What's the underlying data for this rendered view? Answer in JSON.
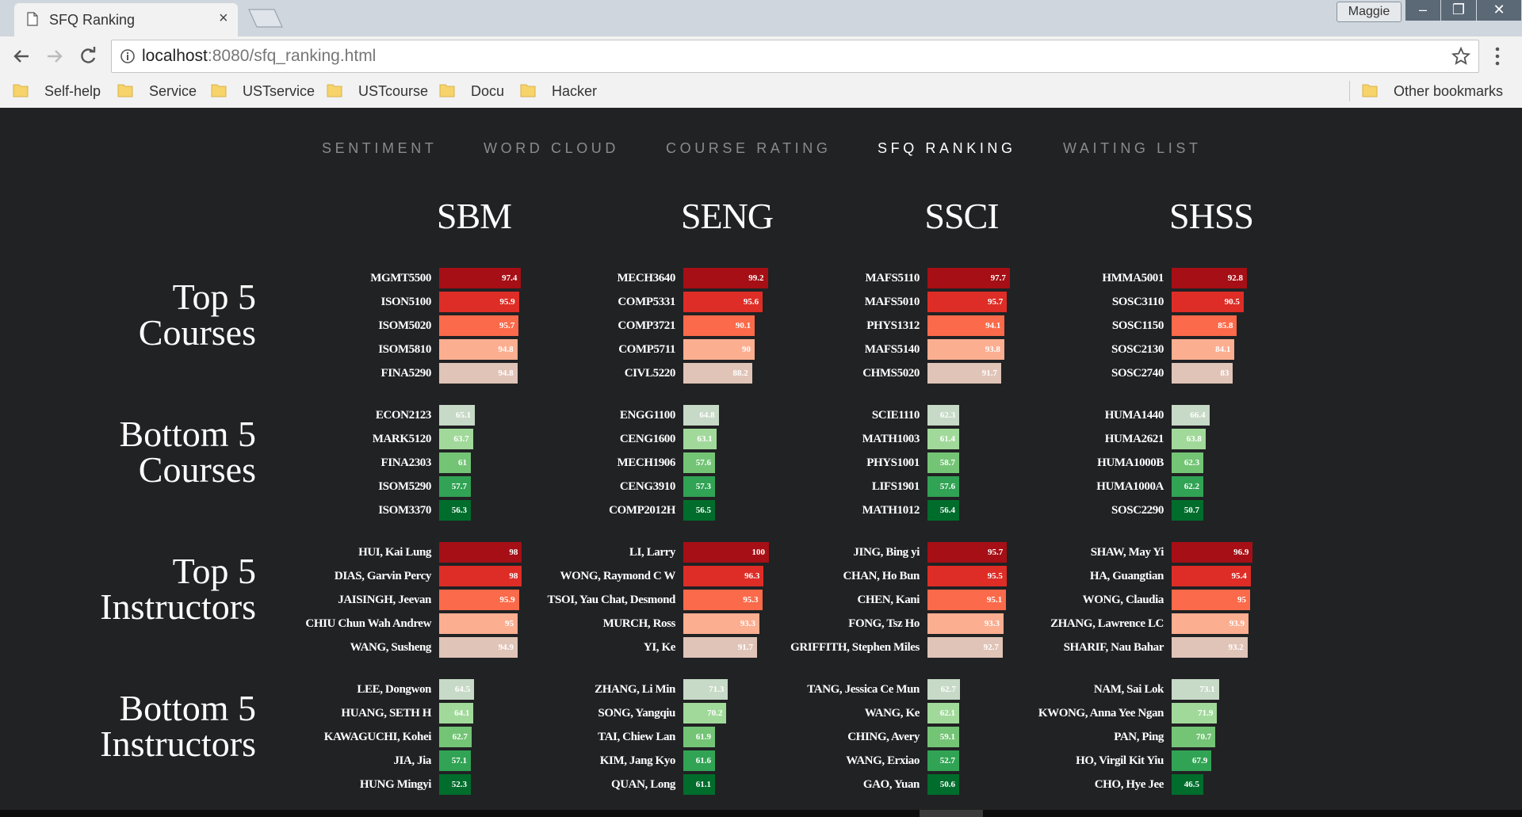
{
  "browser": {
    "tab_title": "SFQ Ranking",
    "url_host": "localhost",
    "url_rest": ":8080/sfq_ranking.html",
    "profile_name": "Maggie",
    "bookmarks": [
      "Self-help",
      "Service",
      "USTservice",
      "USTcourse",
      "Docu",
      "Hacker"
    ],
    "other_bookmarks": "Other bookmarks"
  },
  "nav": {
    "items": [
      "SENTIMENT",
      "WORD CLOUD",
      "COURSE RATING",
      "SFQ RANKING",
      "WAITING LIST"
    ],
    "active": "SFQ RANKING"
  },
  "schools": [
    "SBM",
    "SENG",
    "SSCI",
    "SHSS"
  ],
  "sections": [
    {
      "title_line1": "Top 5",
      "title_line2": "Courses",
      "kind": "top"
    },
    {
      "title_line1": "Bottom 5",
      "title_line2": "Courses",
      "kind": "bottom"
    },
    {
      "title_line1": "Top 5",
      "title_line2": "Instructors",
      "kind": "top"
    },
    {
      "title_line1": "Bottom 5",
      "title_line2": "Instructors",
      "kind": "bottom"
    }
  ],
  "colors": {
    "top": [
      "#a50f15",
      "#de2d26",
      "#fb6a4a",
      "#fcae91",
      "#e0c4b8"
    ],
    "bottom": [
      "#c7d9c7",
      "#a1d99b",
      "#74c476",
      "#31a354",
      "#006d2c"
    ],
    "background": "#212224"
  },
  "chart_data": {
    "type": "bar",
    "value_scale_max": 100,
    "rankings": [
      [
        [
          [
            "MGMT5500",
            97.4
          ],
          [
            "ISON5100",
            95.9
          ],
          [
            "ISOM5020",
            95.7
          ],
          [
            "ISOM5810",
            94.8
          ],
          [
            "FINA5290",
            94.8
          ]
        ],
        [
          [
            "MECH3640",
            99.2
          ],
          [
            "COMP5331",
            95.6
          ],
          [
            "COMP3721",
            90.1
          ],
          [
            "COMP5711",
            90
          ],
          [
            "CIVL5220",
            88.2
          ]
        ],
        [
          [
            "MAFS5110",
            97.7
          ],
          [
            "MAFS5010",
            95.7
          ],
          [
            "PHYS1312",
            94.1
          ],
          [
            "MAFS5140",
            93.8
          ],
          [
            "CHMS5020",
            91.7
          ]
        ],
        [
          [
            "HMMA5001",
            92.8
          ],
          [
            "SOSC3110",
            90.5
          ],
          [
            "SOSC1150",
            85.8
          ],
          [
            "SOSC2130",
            84.1
          ],
          [
            "SOSC2740",
            83
          ]
        ]
      ],
      [
        [
          [
            "ECON2123",
            65.1
          ],
          [
            "MARK5120",
            63.7
          ],
          [
            "FINA2303",
            61
          ],
          [
            "ISOM5290",
            57.7
          ],
          [
            "ISOM3370",
            56.3
          ]
        ],
        [
          [
            "ENGG1100",
            64.8
          ],
          [
            "CENG1600",
            63.1
          ],
          [
            "MECH1906",
            57.6
          ],
          [
            "CENG3910",
            57.3
          ],
          [
            "COMP2012H",
            56.5
          ]
        ],
        [
          [
            "SCIE1110",
            62.3
          ],
          [
            "MATH1003",
            61.4
          ],
          [
            "PHYS1001",
            58.7
          ],
          [
            "LIFS1901",
            57.6
          ],
          [
            "MATH1012",
            56.4
          ]
        ],
        [
          [
            "HUMA1440",
            66.4
          ],
          [
            "HUMA2621",
            63.8
          ],
          [
            "HUMA1000B",
            62.3
          ],
          [
            "HUMA1000A",
            62.2
          ],
          [
            "SOSC2290",
            50.7
          ]
        ]
      ],
      [
        [
          [
            "HUI, Kai Lung",
            98
          ],
          [
            "DIAS, Garvin Percy",
            98
          ],
          [
            "JAISINGH, Jeevan",
            95.9
          ],
          [
            "CHIU Chun Wah Andrew",
            95
          ],
          [
            "WANG, Susheng",
            94.9
          ]
        ],
        [
          [
            "LI, Larry",
            100
          ],
          [
            "WONG, Raymond C W",
            96.3
          ],
          [
            "TSOI, Yau Chat, Desmond",
            95.3
          ],
          [
            "MURCH, Ross",
            93.3
          ],
          [
            "YI, Ke",
            91.7
          ]
        ],
        [
          [
            "JING, Bing yi",
            95.7
          ],
          [
            "CHAN, Ho Bun",
            95.5
          ],
          [
            "CHEN, Kani",
            95.1
          ],
          [
            "FONG, Tsz Ho",
            93.3
          ],
          [
            "GRIFFITH, Stephen Miles",
            92.7
          ]
        ],
        [
          [
            "SHAW, May Yi",
            96.9
          ],
          [
            "HA, Guangtian",
            95.4
          ],
          [
            "WONG, Claudia",
            95
          ],
          [
            "ZHANG, Lawrence LC",
            93.9
          ],
          [
            "SHARIF, Nau Bahar",
            93.2
          ]
        ]
      ],
      [
        [
          [
            "LEE, Dongwon",
            64.5
          ],
          [
            "HUANG, SETH H",
            64.1
          ],
          [
            "KAWAGUCHI, Kohei",
            62.7
          ],
          [
            "JIA, Jia",
            57.1
          ],
          [
            "HUNG Mingyi",
            52.3
          ]
        ],
        [
          [
            "ZHANG, Li Min",
            71.3
          ],
          [
            "SONG, Yangqiu",
            70.2
          ],
          [
            "TAI, Chiew Lan",
            61.9
          ],
          [
            "KIM, Jang Kyo",
            61.6
          ],
          [
            "QUAN, Long",
            61.1
          ]
        ],
        [
          [
            "TANG, Jessica Ce Mun",
            62.7
          ],
          [
            "WANG, Ke",
            62.1
          ],
          [
            "CHING, Avery",
            59.1
          ],
          [
            "WANG, Erxiao",
            52.7
          ],
          [
            "GAO, Yuan",
            50.6
          ]
        ],
        [
          [
            "NAM, Sai Lok",
            73.1
          ],
          [
            "KWONG, Anna Yee Ngan",
            71.9
          ],
          [
            "PAN, Ping",
            70.7
          ],
          [
            "HO, Virgil Kit Yiu",
            67.9
          ],
          [
            "CHO, Hye Jee",
            46.5
          ]
        ]
      ]
    ]
  }
}
